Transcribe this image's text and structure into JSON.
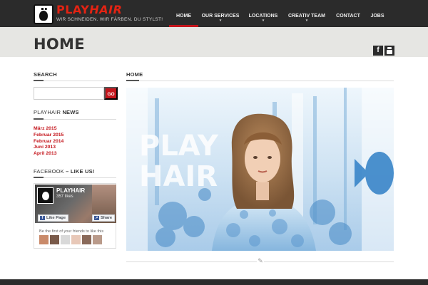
{
  "brand": {
    "name_part1": "PLAY",
    "name_part2": "HAIR",
    "tagline": "WIR SCHNEIDEN. WIR FÄRBEN. DU STYLST!"
  },
  "nav": {
    "items": [
      {
        "label": "HOME",
        "active": true
      },
      {
        "label": "OUR SERVICES",
        "caret": true
      },
      {
        "label": "LOCATIONS",
        "caret": true
      },
      {
        "label": "CREATIV TEAM",
        "caret": true
      },
      {
        "label": "CONTACT"
      },
      {
        "label": "JOBS"
      }
    ],
    "caret_glyph": "▾"
  },
  "page": {
    "title": "HOME"
  },
  "social": {
    "facebook_glyph": "f",
    "youtube_icon": "youtube-icon"
  },
  "sidebar": {
    "search_heading": "SEARCH",
    "search_placeholder": "",
    "search_button": "GO",
    "news_heading_part1": "PLAYHAIR",
    "news_heading_part2": "NEWS",
    "news_items": [
      "März 2015",
      "Februar 2015",
      "Februar 2014",
      "Juni 2013",
      "April 2013"
    ],
    "facebook_heading_part1": "FACEBOOK",
    "facebook_heading_part2": "– LIKE US!"
  },
  "fb_widget": {
    "page_name": "PLAYHAIR",
    "likes": "357 likes",
    "like_button": "Like Page",
    "share_button": "Share",
    "friends_text": "Be the first of your friends to like this",
    "face_colors": [
      "#c98a6a",
      "#7a5a4a",
      "#d9d9d9",
      "#e8c8b8",
      "#8a6a5a",
      "#b99a8a"
    ]
  },
  "main": {
    "heading": "HOME",
    "hero_text": "PLAY HAIR"
  },
  "colors": {
    "accent": "#c4151c",
    "dark": "#2b2b2b",
    "title_band": "#e6e6e3"
  }
}
